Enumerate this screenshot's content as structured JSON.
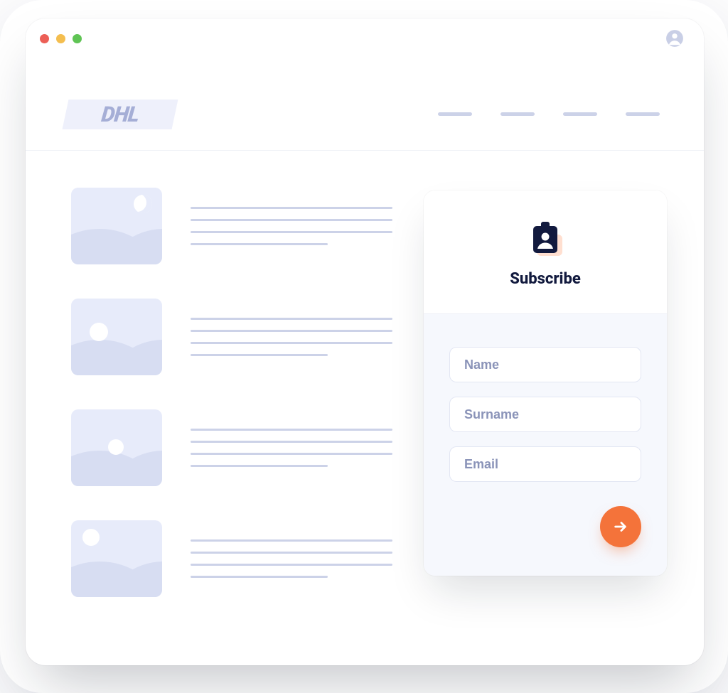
{
  "brand": {
    "logo_text": "DHL"
  },
  "subscribe": {
    "title": "Subscribe",
    "fields": {
      "name_placeholder": "Name",
      "surname_placeholder": "Surname",
      "email_placeholder": "Email"
    }
  },
  "colors": {
    "accent": "#f4733a",
    "muted": "#ccd2e8",
    "card_icon": "#121a3e",
    "card_icon_accent": "#ffdfd0"
  }
}
